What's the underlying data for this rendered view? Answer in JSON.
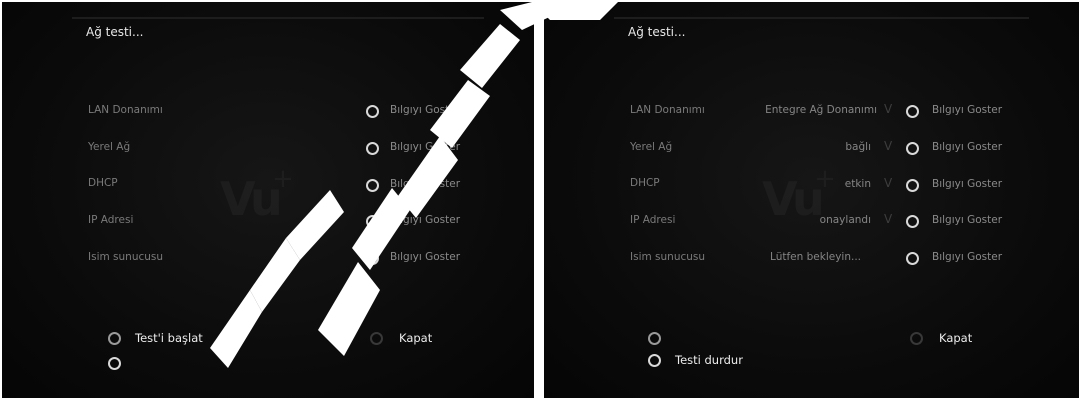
{
  "colors": {
    "panel_bg": "#0b0b0b",
    "text_bright": "#e8e8e8",
    "text_dim": "#7a7a7a",
    "watermark": "#ffffff"
  },
  "left_panel": {
    "title": "Ağ testi...",
    "rows": [
      {
        "label": "LAN Donanımı",
        "info_label": "Bılgıyı Goster"
      },
      {
        "label": "Yerel Ağ",
        "info_label": "Bılgıyı Goster"
      },
      {
        "label": "DHCP",
        "info_label": "Bılgıyı Goster"
      },
      {
        "label": "IP Adresi",
        "info_label": "Bılgıyı Goster"
      },
      {
        "label": "Isim sunucusu",
        "info_label": "Bılgıyı Goster"
      }
    ],
    "start_label": "Test'i başlat",
    "close_label": "Kapat"
  },
  "right_panel": {
    "title": "Ağ testi...",
    "rows": [
      {
        "label": "LAN Donanımı",
        "status": "Entegre Ağ Donanımı",
        "check": "V",
        "info_label": "Bılgıyı Goster"
      },
      {
        "label": "Yerel Ağ",
        "status": "bağlı",
        "check": "V",
        "info_label": "Bılgıyı Goster"
      },
      {
        "label": "DHCP",
        "status": "etkin",
        "check": "V",
        "info_label": "Bılgıyı Goster"
      },
      {
        "label": "IP Adresi",
        "status": "onaylandı",
        "check": "V",
        "info_label": "Bılgıyı Goster"
      },
      {
        "label": "Isim sunucusu",
        "status": "Lütfen bekleyin...",
        "check": "",
        "info_label": "Bılgıyı Goster"
      }
    ],
    "stop_label": "Testi durdur",
    "close_label": "Kapat"
  },
  "logo": {
    "text": "Vu",
    "plus": "+"
  },
  "icons": {
    "radio": "radio-button-icon",
    "check": "check-mark-icon"
  }
}
